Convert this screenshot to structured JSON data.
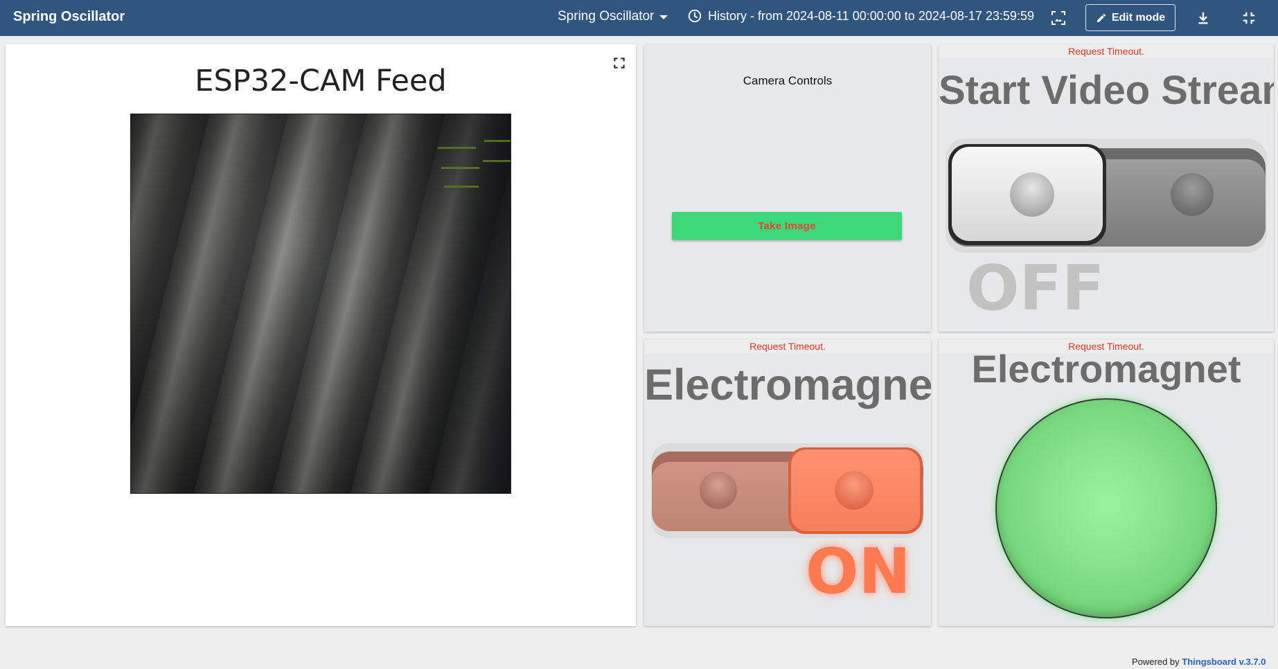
{
  "toolbar": {
    "title": "Spring Oscillator",
    "state_select": "Spring Oscillator",
    "history": "History - from 2024-08-11 00:00:00 to 2024-08-17 23:59:59",
    "edit_mode": "Edit mode",
    "icons": [
      "clock-icon",
      "fit-screen-icon",
      "edit-pencil-icon",
      "download-icon",
      "exit-fullscreen-icon"
    ]
  },
  "camera_widget": {
    "title": "ESP32-CAM Feed",
    "icon": "fullscreen-icon"
  },
  "camera_controls": {
    "label": "Camera Controls",
    "take_image": "Take Image"
  },
  "video_stream": {
    "error": "Request Timeout.",
    "title": "Start Video Stream",
    "toggle_on": false,
    "state_label": "OFF"
  },
  "electromagnet_switch": {
    "error": "Request Timeout.",
    "title": "Electromagnet",
    "toggle_on": true,
    "state_label": "ON"
  },
  "electromagnet_indicator": {
    "error": "Request Timeout.",
    "title": "Electromagnet",
    "active": true
  },
  "footer": {
    "powered_prefix": "Powered by",
    "brand": "Thingsboard v.3.7.0"
  },
  "colors": {
    "toolbar_bg": "#305680",
    "take_image_bg": "#3dd879",
    "error_text": "#e53322",
    "on_color": "#ff7a50",
    "indicator_green": "#86e38b"
  }
}
